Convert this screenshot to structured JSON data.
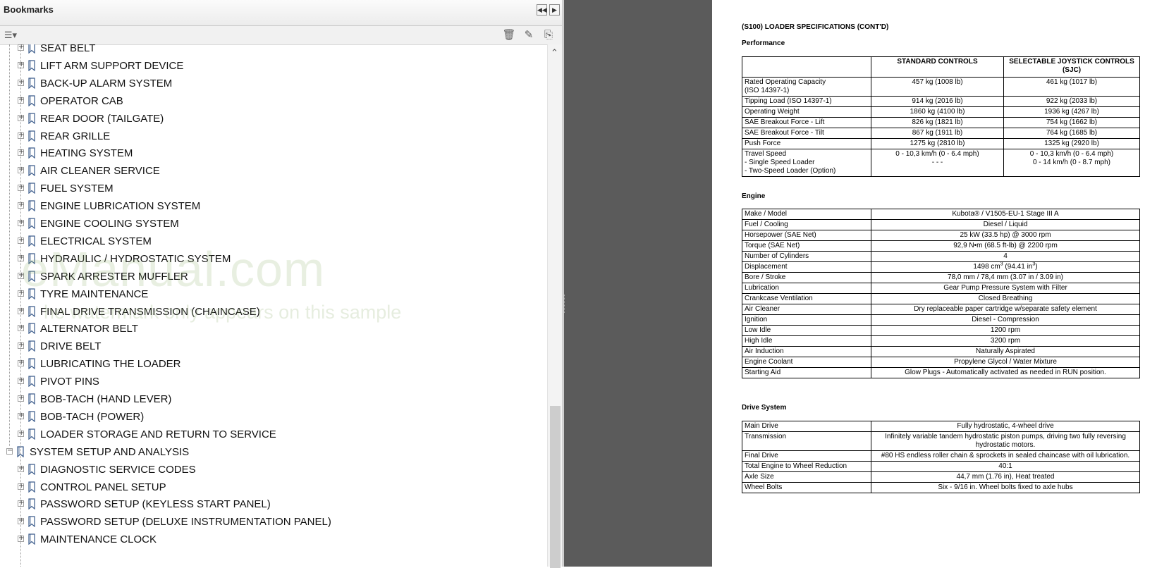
{
  "bookmarks": {
    "title": "Bookmarks",
    "items": [
      {
        "label": "SEAT BELT",
        "level": 2
      },
      {
        "label": "LIFT ARM SUPPORT DEVICE",
        "level": 2
      },
      {
        "label": "BACK-UP ALARM SYSTEM",
        "level": 2
      },
      {
        "label": "OPERATOR CAB",
        "level": 2
      },
      {
        "label": "REAR DOOR (TAILGATE)",
        "level": 2
      },
      {
        "label": "REAR GRILLE",
        "level": 2
      },
      {
        "label": "HEATING SYSTEM",
        "level": 2
      },
      {
        "label": "AIR CLEANER SERVICE",
        "level": 2
      },
      {
        "label": "FUEL SYSTEM",
        "level": 2
      },
      {
        "label": "ENGINE LUBRICATION SYSTEM",
        "level": 2
      },
      {
        "label": "ENGINE COOLING SYSTEM",
        "level": 2
      },
      {
        "label": "ELECTRICAL SYSTEM",
        "level": 2
      },
      {
        "label": "HYDRAULIC / HYDROSTATIC SYSTEM",
        "level": 2
      },
      {
        "label": "SPARK ARRESTER MUFFLER",
        "level": 2
      },
      {
        "label": "TYRE MAINTENANCE",
        "level": 2
      },
      {
        "label": "FINAL DRIVE TRANSMISSION (CHAINCASE)",
        "level": 2
      },
      {
        "label": "ALTERNATOR BELT",
        "level": 2
      },
      {
        "label": "DRIVE BELT",
        "level": 2
      },
      {
        "label": "LUBRICATING THE LOADER",
        "level": 2
      },
      {
        "label": "PIVOT PINS",
        "level": 2
      },
      {
        "label": "BOB-TACH (HAND LEVER)",
        "level": 2
      },
      {
        "label": "BOB-TACH (POWER)",
        "level": 2
      },
      {
        "label": "LOADER STORAGE AND RETURN TO SERVICE",
        "level": 2
      },
      {
        "label": "SYSTEM SETUP AND ANALYSIS",
        "level": 1
      },
      {
        "label": "DIAGNOSTIC SERVICE CODES",
        "level": 2
      },
      {
        "label": "CONTROL PANEL SETUP",
        "level": 2
      },
      {
        "label": "PASSWORD SETUP (KEYLESS START PANEL)",
        "level": 2
      },
      {
        "label": "PASSWORD SETUP (DELUXE INSTRUMENTATION PANEL)",
        "level": 2
      },
      {
        "label": "MAINTENANCE CLOCK",
        "level": 2
      }
    ]
  },
  "watermark": {
    "line1": "eManual.com",
    "line2": "he watermark only appears on this sample"
  },
  "doc": {
    "title": "(S100) LOADER SPECIFICATIONS (CONT'D)",
    "performance": {
      "heading": "Performance",
      "col_standard": "STANDARD CONTROLS",
      "col_sjc": "SELECTABLE JOYSTICK CONTROLS (SJC)",
      "rows": [
        {
          "label": "Rated Operating Capacity\n(ISO 14397-1)",
          "std": "457 kg (1008 lb)",
          "sjc": "461 kg (1017 lb)"
        },
        {
          "label": "Tipping Load (ISO 14397-1)",
          "std": "914 kg (2016 lb)",
          "sjc": "922 kg (2033 lb)"
        },
        {
          "label": "Operating Weight",
          "std": "1860 kg (4100 lb)",
          "sjc": "1936 kg (4267 lb)"
        },
        {
          "label": "SAE Breakout Force   - Lift",
          "std": "826 kg (1821 lb)",
          "sjc": "754 kg (1662 lb)"
        },
        {
          "label": "SAE Breakout Force   - Tilt",
          "std": "867 kg (1911 lb)",
          "sjc": "764 kg (1685 lb)"
        },
        {
          "label": "Push Force",
          "std": "1275 kg (2810 lb)",
          "sjc": "1325 kg (2920 lb)"
        },
        {
          "label": "Travel Speed\n - Single Speed Loader\n - Two-Speed Loader (Option)",
          "std": "0 - 10,3 km/h (0 - 6.4 mph)\n- - -",
          "sjc": "0 - 10,3 km/h (0 - 6.4 mph)\n0 - 14 km/h (0 - 8.7 mph)"
        }
      ]
    },
    "engine": {
      "heading": "Engine",
      "rows": [
        {
          "label": "Make / Model",
          "value": "Kubota® / V1505-EU-1 Stage III A"
        },
        {
          "label": "Fuel / Cooling",
          "value": "Diesel / Liquid"
        },
        {
          "label": "Horsepower (SAE Net)",
          "value": "25 kW (33.5 hp) @ 3000 rpm"
        },
        {
          "label": "Torque (SAE Net)",
          "value": "92,9 N•m (68.5 ft-lb) @ 2200 rpm"
        },
        {
          "label": "Number of Cylinders",
          "value": "4"
        },
        {
          "label": "Displacement",
          "value": "1498 cm",
          "sup1": "3",
          "mid": " (94.41 in",
          "sup2": "3",
          "end": ")"
        },
        {
          "label": "Bore / Stroke",
          "value": "78,0 mm / 78,4 mm (3.07 in / 3.09 in)"
        },
        {
          "label": "Lubrication",
          "value": "Gear Pump Pressure System with Filter"
        },
        {
          "label": "Crankcase Ventilation",
          "value": "Closed Breathing"
        },
        {
          "label": "Air Cleaner",
          "value": "Dry replaceable paper cartridge w/separate safety element"
        },
        {
          "label": "Ignition",
          "value": "Diesel - Compression"
        },
        {
          "label": "Low Idle",
          "value": "1200 rpm"
        },
        {
          "label": "High Idle",
          "value": "3200 rpm"
        },
        {
          "label": "Air Induction",
          "value": "Naturally Aspirated"
        },
        {
          "label": "Engine Coolant",
          "value": "Propylene Glycol / Water Mixture"
        },
        {
          "label": "Starting Aid",
          "value": "Glow Plugs - Automatically activated as needed in RUN position."
        }
      ]
    },
    "drive": {
      "heading": "Drive System",
      "rows": [
        {
          "label": "Main Drive",
          "value": "Fully hydrostatic, 4-wheel drive"
        },
        {
          "label": "Transmission",
          "value": "Infinitely variable tandem hydrostatic piston pumps, driving two fully reversing hydrostatic motors."
        },
        {
          "label": "Final Drive",
          "value": "#80 HS endless roller chain & sprockets in sealed chaincase with oil lubrication."
        },
        {
          "label": "Total Engine to Wheel Reduction",
          "value": "40:1"
        },
        {
          "label": "Axle Size",
          "value": "44,7 mm (1.76 in), Heat treated"
        },
        {
          "label": "Wheel Bolts",
          "value": "Six - 9/16 in. Wheel bolts fixed to axle hubs"
        }
      ]
    }
  }
}
